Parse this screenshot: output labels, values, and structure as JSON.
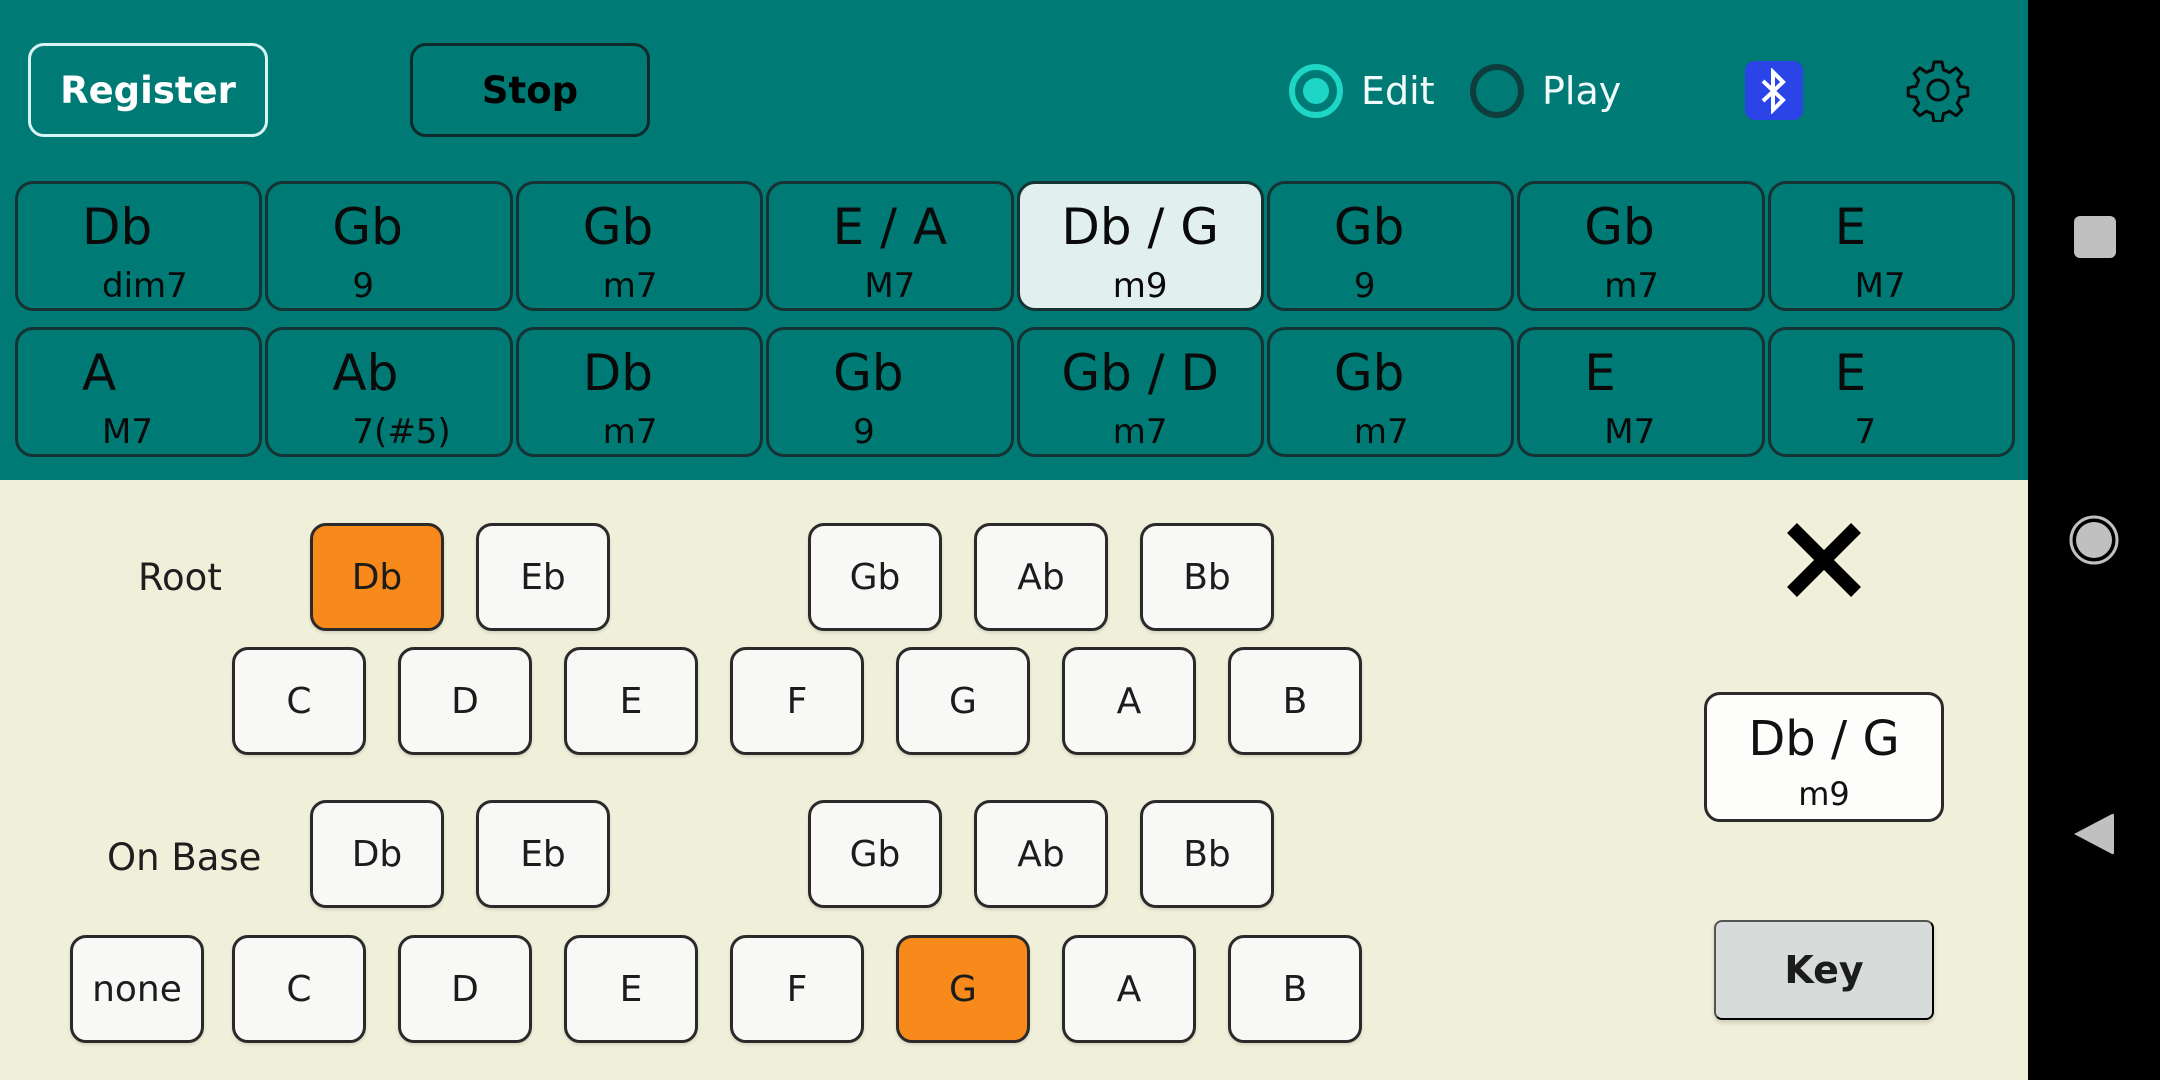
{
  "toolbar": {
    "register_label": "Register",
    "stop_label": "Stop",
    "mode": {
      "options": [
        {
          "label": "Edit",
          "selected": true
        },
        {
          "label": "Play",
          "selected": false
        }
      ]
    },
    "bluetooth_icon": "bluetooth-icon",
    "settings_icon": "gear-icon",
    "colors": {
      "teal_bg": "#007a75",
      "radio_accent": "#1dd6c6",
      "bluetooth_bg": "#2a44e8"
    }
  },
  "chord_sequence": {
    "rows": [
      [
        {
          "root": "Db",
          "quality": "dim7",
          "selected": false
        },
        {
          "root": "Gb",
          "quality": "9",
          "selected": false
        },
        {
          "root": "Gb",
          "quality": "m7",
          "selected": false
        },
        {
          "root": "E / A",
          "quality": "M7",
          "selected": false
        },
        {
          "root": "Db / G",
          "quality": "m9",
          "selected": true
        },
        {
          "root": "Gb",
          "quality": "9",
          "selected": false
        },
        {
          "root": "Gb",
          "quality": "m7",
          "selected": false
        },
        {
          "root": "E",
          "quality": "M7",
          "selected": false
        }
      ],
      [
        {
          "root": "A",
          "quality": "M7",
          "selected": false
        },
        {
          "root": "Ab",
          "quality": "7(#5)",
          "selected": false
        },
        {
          "root": "Db",
          "quality": "m7",
          "selected": false
        },
        {
          "root": "Gb",
          "quality": "9",
          "selected": false
        },
        {
          "root": "Gb / D",
          "quality": "m7",
          "selected": false
        },
        {
          "root": "Gb",
          "quality": "m7",
          "selected": false
        },
        {
          "root": "E",
          "quality": "M7",
          "selected": false
        },
        {
          "root": "E",
          "quality": "7",
          "selected": false
        }
      ]
    ]
  },
  "editor": {
    "root_label": "Root",
    "on_base_label": "On Base",
    "root_selected": "Db",
    "on_base_selected": "G",
    "sharp_keys": [
      "Db",
      "Eb",
      "Gb",
      "Ab",
      "Bb"
    ],
    "natural_keys": [
      "C",
      "D",
      "E",
      "F",
      "G",
      "A",
      "B"
    ],
    "none_label": "none",
    "active_color": "#f78a1a",
    "close_icon": "close-icon",
    "current_chord": {
      "root": "Db / G",
      "quality": "m9"
    },
    "key_button_label": "Key"
  },
  "navbar": {
    "recents_icon": "square-icon",
    "home_icon": "circle-icon",
    "back_icon": "triangle-back-icon"
  }
}
